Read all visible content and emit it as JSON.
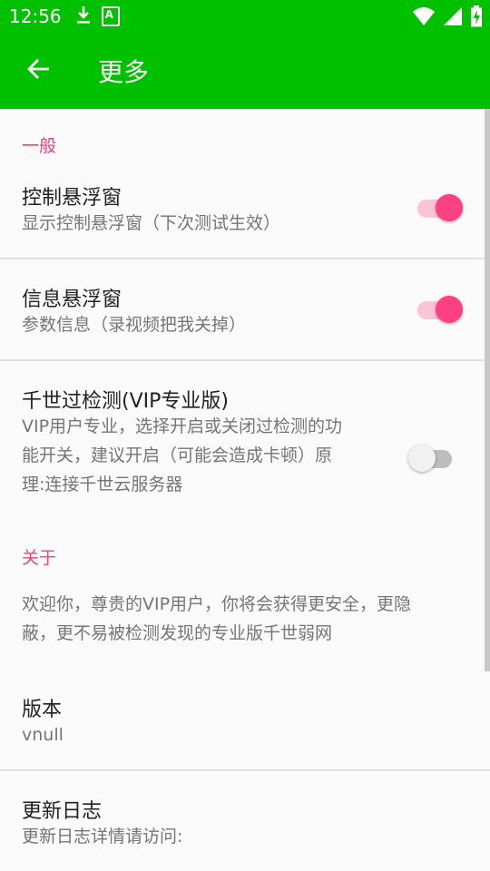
{
  "status_bar": {
    "time": "12:56",
    "left_icons": [
      "download-icon",
      "a-badge-icon"
    ],
    "right_icons": [
      "wifi-icon",
      "signal-icon",
      "battery-charging-icon"
    ],
    "a_badge": "A"
  },
  "toolbar": {
    "title": "更多",
    "background": "#00c000"
  },
  "sections": {
    "general": {
      "header": "一般"
    },
    "about": {
      "header": "关于"
    }
  },
  "prefs": {
    "control_float": {
      "title": "控制悬浮窗",
      "summary": "显示控制悬浮窗（下次测试生效）",
      "checked": true
    },
    "info_float": {
      "title": "信息悬浮窗",
      "summary": "参数信息（录视频把我关掉）",
      "checked": true
    },
    "vip_bypass": {
      "title": "千世过检测(VIP专业版)",
      "summary_lines": [
        "VIP用户专业，选择开启或关闭过检测的功",
        "能开关，建议开启（可能会造成卡顿）原",
        "理:连接千世云服务器"
      ],
      "checked": false
    },
    "about_text_lines": [
      "欢迎你，尊贵的VIP用户，你将会获得更安全，更隐",
      "蔽，更不易被检测发现的专业版千世弱网"
    ],
    "version": {
      "title": "版本",
      "summary": "vnull"
    },
    "changelog": {
      "title": "更新日志",
      "summary": "更新日志详情请访问:"
    }
  },
  "colors": {
    "accent": "#ff4081",
    "category": "#e8457a",
    "primary": "#00c000"
  }
}
